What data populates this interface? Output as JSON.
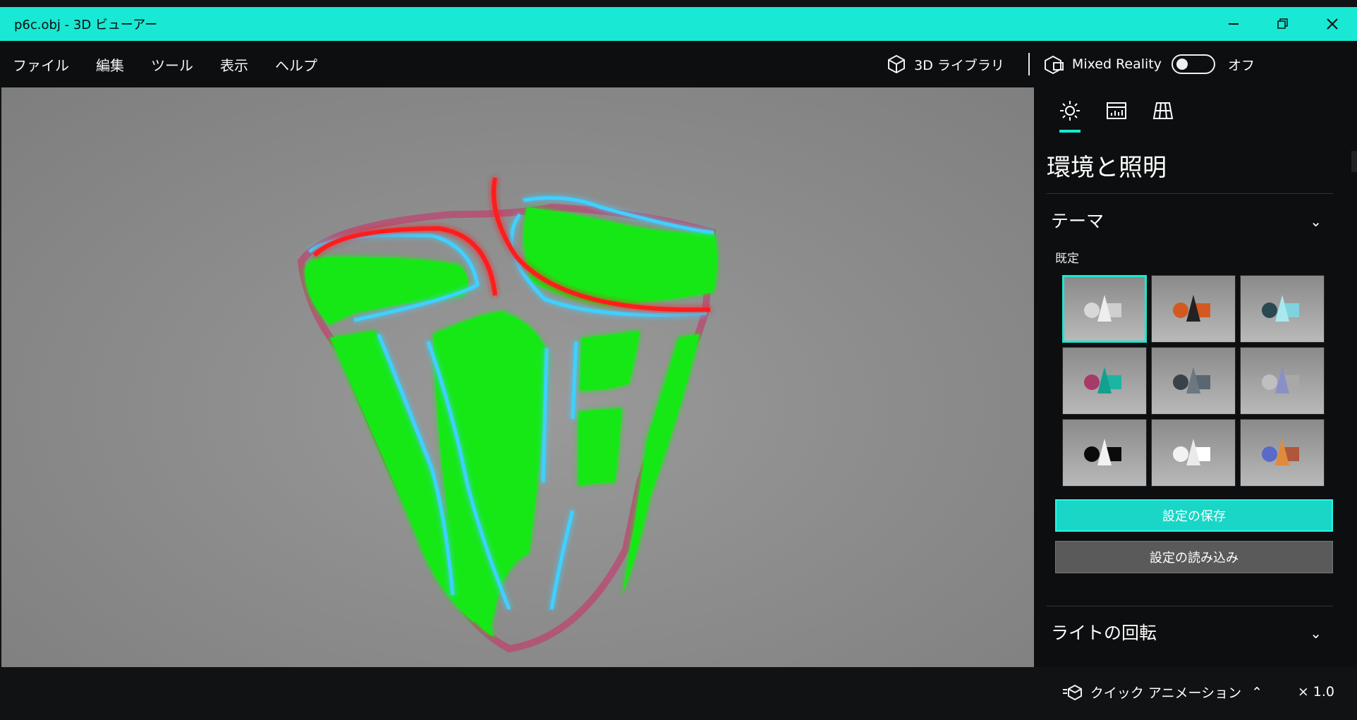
{
  "window": {
    "title": "p6c.obj - 3D ビューアー"
  },
  "menu": [
    "ファイル",
    "編集",
    "ツール",
    "表示",
    "ヘルプ"
  ],
  "toolbar": {
    "library_label": "3D ライブラリ",
    "mixed_reality_label": "Mixed Reality",
    "toggle_state": "オフ"
  },
  "panel": {
    "title": "環境と照明",
    "theme_section": "テーマ",
    "default_label": "既定",
    "themes": [
      {
        "name": "theme-1",
        "accent": "#cfcfcf"
      },
      {
        "name": "theme-2",
        "accent": "#d25a22"
      },
      {
        "name": "theme-3",
        "accent": "#7fd3dc"
      },
      {
        "name": "theme-4",
        "accent": "#1bb6a2"
      },
      {
        "name": "theme-5",
        "accent": "#5a6670"
      },
      {
        "name": "theme-6",
        "accent": "#8b8fc7"
      },
      {
        "name": "theme-7",
        "accent": "#0b0b0b"
      },
      {
        "name": "theme-8",
        "accent": "#f2f2f2"
      },
      {
        "name": "theme-9",
        "accent": "#e08a3d"
      }
    ],
    "save_button": "設定の保存",
    "load_button": "設定の読み込み",
    "light_section": "ライトの回転"
  },
  "status": {
    "quick_animation": "クイック アニメーション",
    "zoom": "× 1.0"
  },
  "colors": {
    "accent": "#19e8d4",
    "model_green": "#18e818",
    "edge_blue": "#3fd0ff",
    "edge_red": "#ff1f1f"
  }
}
